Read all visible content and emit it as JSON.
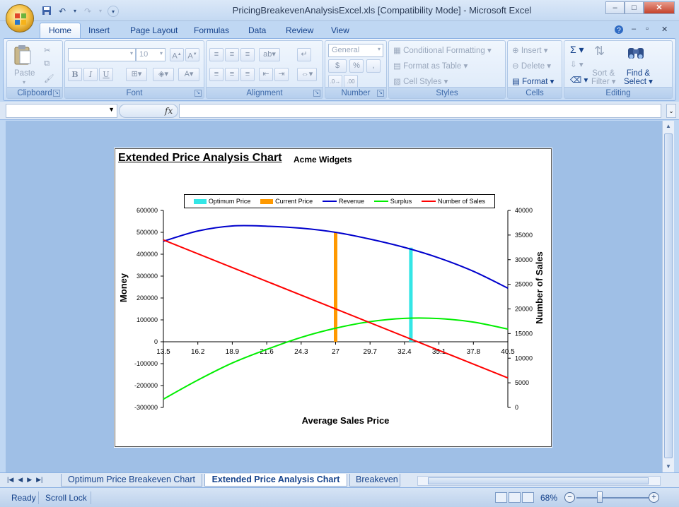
{
  "window": {
    "title": "PricingBreakevenAnalysisExcel.xls  [Compatibility Mode] - Microsoft Excel",
    "minimize": "–",
    "maximize": "□",
    "close": "✕"
  },
  "ribbon_tabs": [
    "Home",
    "Insert",
    "Page Layout",
    "Formulas",
    "Data",
    "Review",
    "View"
  ],
  "ribbon": {
    "clipboard": {
      "label": "Clipboard",
      "paste": "Paste"
    },
    "font": {
      "label": "Font",
      "size": "10",
      "bold": "B",
      "italic": "I",
      "underline": "U"
    },
    "alignment": {
      "label": "Alignment"
    },
    "number": {
      "label": "Number",
      "format": "General",
      "currency": "$",
      "percent": "%",
      "comma": ","
    },
    "styles": {
      "label": "Styles",
      "conditional": "Conditional Formatting",
      "format_table": "Format as Table",
      "cell_styles": "Cell Styles"
    },
    "cells": {
      "label": "Cells",
      "insert": "Insert",
      "delete": "Delete",
      "format": "Format"
    },
    "editing": {
      "label": "Editing",
      "sort_filter_1": "Sort &",
      "sort_filter_2": "Filter",
      "find_1": "Find &",
      "find_2": "Select"
    }
  },
  "formula_bar": {
    "name_box": "",
    "fx": "fx",
    "formula": ""
  },
  "chart_data": {
    "type": "line",
    "title": "Extended Price Analysis  Chart",
    "subtitle": "Acme Widgets",
    "xlabel": "Average Sales Price",
    "ylabel": "Money",
    "y2label": "Number of Sales",
    "x_ticks": [
      "13.5",
      "16.2",
      "18.9",
      "21.6",
      "24.3",
      "27",
      "29.7",
      "32.4",
      "35.1",
      "37.8",
      "40.5"
    ],
    "y_ticks": [
      "600000",
      "500000",
      "400000",
      "300000",
      "200000",
      "100000",
      "0",
      "-100000",
      "-200000",
      "-300000"
    ],
    "y2_ticks": [
      "40000",
      "35000",
      "30000",
      "25000",
      "20000",
      "15000",
      "10000",
      "5000",
      "0"
    ],
    "xlim": [
      13.5,
      40.5
    ],
    "ylim": [
      -300000,
      600000
    ],
    "y2lim": [
      0,
      40000
    ],
    "legend_position": "top",
    "series": [
      {
        "name": "Optimum Price",
        "kind": "bar",
        "color": "#33e6e6",
        "x": 32.9,
        "y_top": 430000,
        "y_bottom": 0
      },
      {
        "name": "Current Price",
        "kind": "bar",
        "color": "#ff9900",
        "x": 27,
        "y_top": 500000,
        "y_bottom": 0
      },
      {
        "name": "Revenue",
        "kind": "line",
        "axis": "y",
        "color": "#0000cc",
        "x": [
          13.5,
          16.2,
          18.9,
          21.6,
          24.3,
          27,
          29.7,
          32.4,
          35.1,
          37.8,
          40.5
        ],
        "values": [
          459000,
          506000,
          529000,
          528000,
          519000,
          500000,
          469000,
          431000,
          383000,
          322000,
          245000
        ]
      },
      {
        "name": "Surplus",
        "kind": "line",
        "axis": "y",
        "color": "#00ee00",
        "x": [
          13.5,
          16.2,
          18.9,
          21.6,
          24.3,
          27,
          29.7,
          32.4,
          35.1,
          37.8,
          40.5
        ],
        "values": [
          -262000,
          -175000,
          -97000,
          -35000,
          20000,
          62000,
          92000,
          107000,
          106000,
          90000,
          58000
        ]
      },
      {
        "name": "Number of Sales",
        "kind": "line",
        "axis": "y2",
        "color": "#ff0000",
        "x": [
          13.5,
          40.5
        ],
        "values": [
          34000,
          6000
        ]
      }
    ]
  },
  "sheet_tabs": [
    "Optimum Price Breakeven Chart",
    "Extended Price Analysis Chart",
    "Breakeven"
  ],
  "active_sheet": 1,
  "status": {
    "ready": "Ready",
    "scroll_lock": "Scroll Lock",
    "zoom": "68%"
  }
}
